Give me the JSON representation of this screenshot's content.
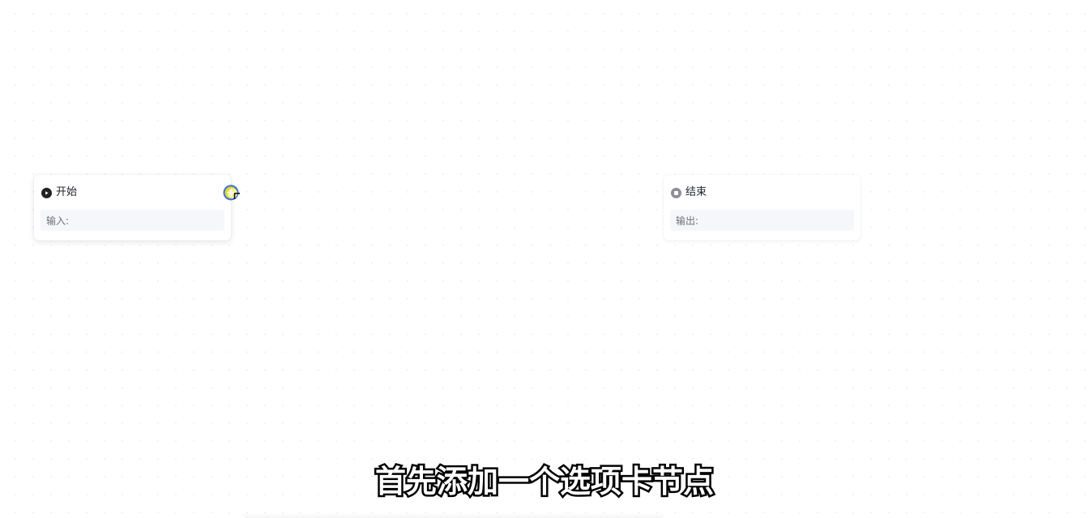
{
  "canvas": {
    "background": "#ffffff"
  },
  "nodes": {
    "start": {
      "title": "开始",
      "icon": "play-icon",
      "field_label": "输入:"
    },
    "end": {
      "title": "结束",
      "icon": "stop-icon",
      "field_label": "输出:"
    }
  },
  "add_handle": {
    "icon": "add-node-icon",
    "accent": "#3b6fd8",
    "highlight": "#f5e12a"
  },
  "subtitle": {
    "text": "首先添加一个选项卡节点"
  }
}
